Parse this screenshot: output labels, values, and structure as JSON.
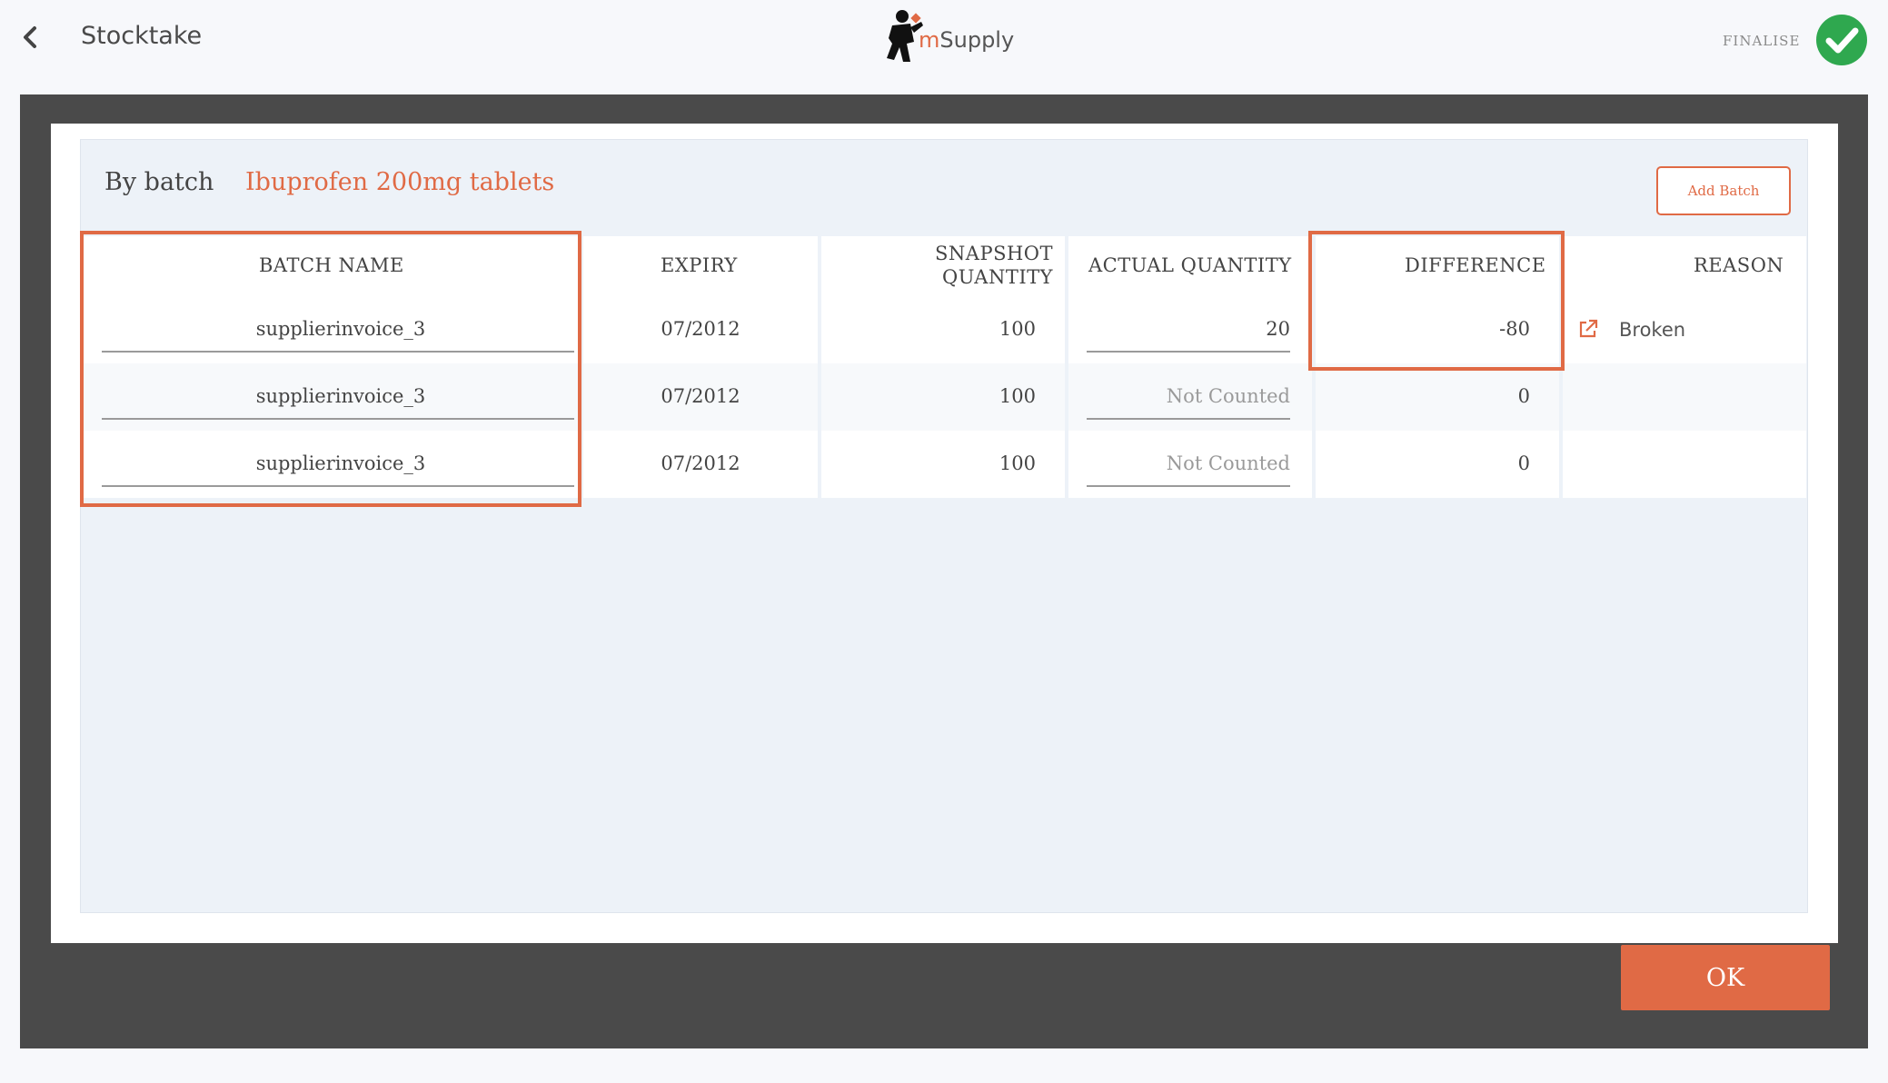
{
  "header": {
    "title": "Stocktake",
    "logo_prefix": "m",
    "logo_text": "Supply",
    "finalise_label": "FINALISE"
  },
  "panel": {
    "mode_label": "By batch",
    "item_name": "Ibuprofen 200mg tablets",
    "add_batch_label": "Add Batch"
  },
  "table": {
    "columns": {
      "batch_name": "BATCH NAME",
      "expiry": "EXPIRY",
      "snapshot_line1": "SNAPSHOT",
      "snapshot_line2": "QUANTITY",
      "actual_quantity": "ACTUAL QUANTITY",
      "difference": "DIFFERENCE",
      "reason": "REASON"
    },
    "rows": [
      {
        "batch_name": "supplierinvoice_3",
        "expiry": "07/2012",
        "snapshot_quantity": "100",
        "actual_quantity": "20",
        "actual_placeholder": "",
        "difference": "-80",
        "reason": "Broken"
      },
      {
        "batch_name": "supplierinvoice_3",
        "expiry": "07/2012",
        "snapshot_quantity": "100",
        "actual_quantity": "",
        "actual_placeholder": "Not Counted",
        "difference": "0",
        "reason": ""
      },
      {
        "batch_name": "supplierinvoice_3",
        "expiry": "07/2012",
        "snapshot_quantity": "100",
        "actual_quantity": "",
        "actual_placeholder": "Not Counted",
        "difference": "0",
        "reason": ""
      }
    ]
  },
  "footer": {
    "ok_label": "OK"
  },
  "colors": {
    "accent": "#e06a45",
    "success": "#2fa84f",
    "frame": "#4a4a4a"
  }
}
